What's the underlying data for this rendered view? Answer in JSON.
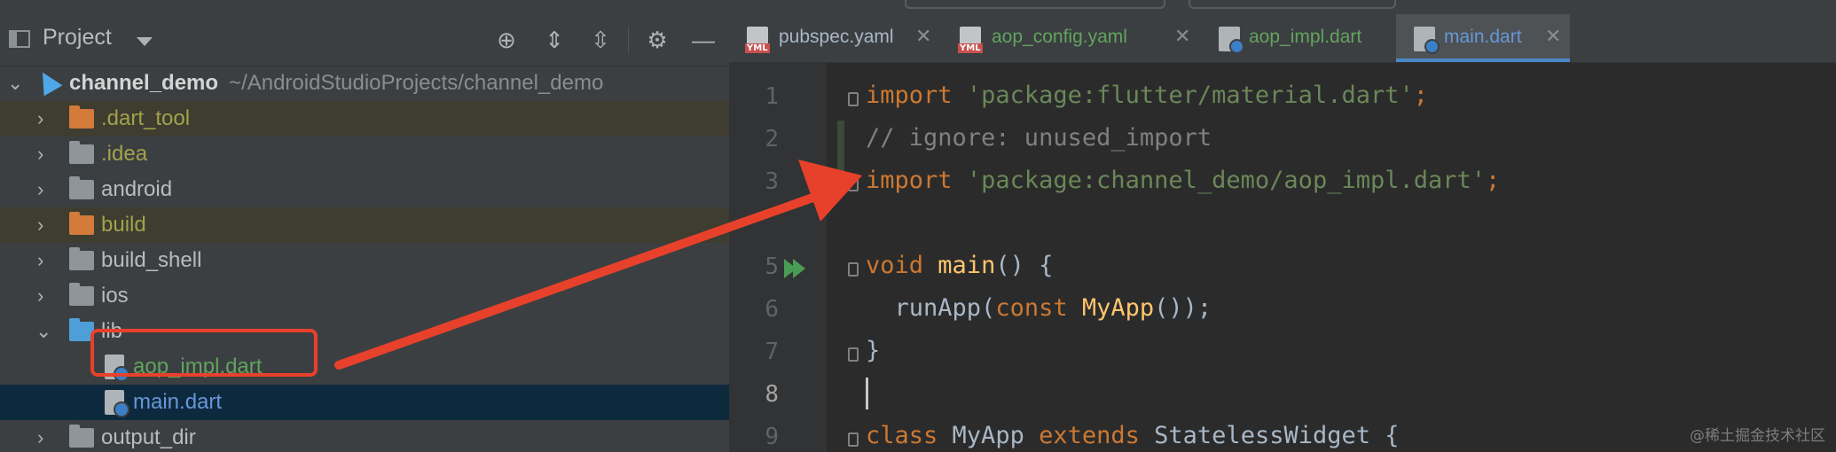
{
  "project_panel": {
    "title": "Project",
    "toolbar_icons": [
      "crosshair-icon",
      "expand-all-icon",
      "collapse-all-icon",
      "gear-icon",
      "minimize-icon"
    ],
    "root": {
      "name": "channel_demo",
      "path": "~/AndroidStudioProjects/channel_demo"
    },
    "items": [
      {
        "label": ".dart_tool",
        "icon": "folder-icon"
      },
      {
        "label": ".idea",
        "icon": "settings-folder-icon"
      },
      {
        "label": "android",
        "icon": "folder-icon"
      },
      {
        "label": "build",
        "icon": "build-folder-icon"
      },
      {
        "label": "build_shell",
        "icon": "folder-icon"
      },
      {
        "label": "ios",
        "icon": "folder-icon"
      },
      {
        "label": "lib",
        "icon": "folder-icon"
      },
      {
        "label": "aop_impl.dart",
        "icon": "dart-file-icon"
      },
      {
        "label": "main.dart",
        "icon": "dart-file-icon"
      },
      {
        "label": "output_dir",
        "icon": "folder-icon"
      }
    ]
  },
  "editor": {
    "tabs": [
      {
        "label": "pubspec.yaml",
        "icon": "yaml-file-icon"
      },
      {
        "label": "aop_config.yaml",
        "icon": "yaml-file-icon"
      },
      {
        "label": "aop_impl.dart",
        "icon": "dart-file-icon"
      },
      {
        "label": "main.dart",
        "icon": "dart-file-icon"
      }
    ],
    "line_numbers": [
      "1",
      "2",
      "3",
      "5",
      "6",
      "7",
      "8",
      "9"
    ],
    "code": {
      "l1_kw": "import",
      "l1_str": "'package:flutter/material.dart'",
      "l1_end": ";",
      "l2_cmt": "// ignore: unused_import",
      "l3_kw": "import",
      "l3_str": "'package:channel_demo/aop_impl.dart'",
      "l3_end": ";",
      "l5_kw": "void",
      "l5_fn": "main",
      "l5_rest": "() {",
      "l6_a": "  runApp(",
      "l6_kw": "const",
      "l6_cls": "MyApp",
      "l6_rest": "());",
      "l7": "}",
      "l9_kw": "class",
      "l9_cls": "MyApp",
      "l9_kw2": "extends",
      "l9_rest": "StatelessWidget {"
    }
  },
  "watermark": "@稀土掘金技术社区",
  "colors": {
    "annotation": "#e8412b",
    "accent": "#4a88c7"
  }
}
